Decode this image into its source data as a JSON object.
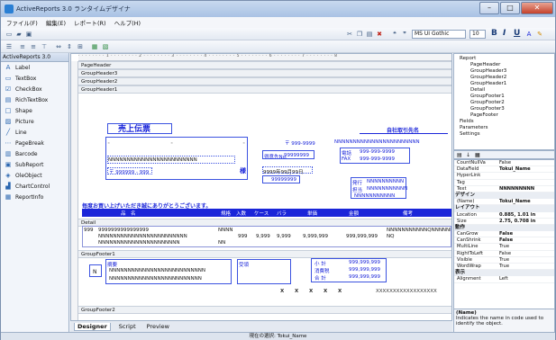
{
  "window": {
    "title": "ActiveReports 3.0 ランタイムデザイナ"
  },
  "menu": [
    "ファイル(F)",
    "編集(E)",
    "レポート(R)",
    "ヘルプ(H)"
  ],
  "toolbar": {
    "font_name": "MS UI Gothic",
    "font_size": "10",
    "bold": "B",
    "italic": "I",
    "underline": "U"
  },
  "toolbox": {
    "header": "ActiveReports 3.0",
    "items": [
      "Label",
      "TextBox",
      "CheckBox",
      "RichTextBox",
      "Shape",
      "Picture",
      "Line",
      "PageBreak",
      "Barcode",
      "SubReport",
      "OleObject",
      "ChartControl",
      "ReportInfo"
    ]
  },
  "bands": {
    "page_header": "PageHeader",
    "group_header3": "GroupHeader3",
    "group_header2": "GroupHeader2",
    "group_header1": "GroupHeader1",
    "detail": "Detail",
    "group_footer1": "GroupFooter1",
    "group_footer2": "GroupFooter2"
  },
  "report": {
    "title": "売上伝票",
    "company": "自社取引先名",
    "postal": "〒 999-9999",
    "address_fill": "NNNNNNNNNNNNNNNNNNNNNNN",
    "tel_label": "電話",
    "tel_value": "999-999-9999",
    "fax_label": "FAX",
    "fax_value": "999-999-9999",
    "customer_no_label": "得意先No.",
    "customer_no_value": "99999999",
    "customer_fill": "NNNNNNNNNNNNNNNNNNNNNNNN",
    "honorific": "様",
    "zip_value": "〒 999999 - 999",
    "date_value": "9999年99月99日",
    "slip_no_value": "99999999",
    "issuer_label": "発行",
    "issuer_value": "NNNNNNNNNN",
    "staff_label": "担当",
    "staff_value": "NNNNNNNNNNN",
    "note_value": "NNNNNNNNNNN",
    "thanks": "毎度お買い上げいただき誠にありがとうございます。",
    "columns": [
      "品　名",
      "規格",
      "入数",
      "ケース",
      "バラ",
      "単価",
      "金額",
      "備考"
    ],
    "detail_code": "999",
    "detail_code_fill": "9999999999999999",
    "detail_name1": "NNNNNNNNNNNNNNNNNNNNNNNN",
    "detail_name2": "NNNNNNNNNNNNNNNNNNNNNN",
    "detail_spec1": "NNNN",
    "detail_spec2": "NN",
    "detail_qty1": "999",
    "detail_qty2": "9,999",
    "detail_qty3": "9,999",
    "detail_price": "9,999,999",
    "detail_amount": "999,999,999",
    "detail_note": "NNNNNNNNNNNQNNNNNNNN NQ",
    "footer_n": "N",
    "footer_remarks_label": "摘要",
    "footer_fill1": "NNNNNNNNNNNNNNNNNNNNNNNNNN",
    "footer_fill2": "NNNNNNNNNNNNNNNNNNNNNNNNN",
    "footer_stamp_label": "受領",
    "subtotal_label": "小 計",
    "tax_label": "消費税",
    "total_label": "合 計",
    "money1": "999,999,999",
    "money2": "999,999,999",
    "money3": "999,999,999",
    "x_marks": [
      "X",
      "X",
      "X",
      "X",
      "X"
    ],
    "x_fill": "XXXXXXXXXXXXXXXXXX"
  },
  "tabs": [
    "Designer",
    "Script",
    "Preview"
  ],
  "status": "現在の選択: Tokui_Name",
  "tree": [
    {
      "label": "Report"
    },
    {
      "label": "PageHeader"
    },
    {
      "label": "GroupHeader3"
    },
    {
      "label": "GroupHeader2"
    },
    {
      "label": "GroupHeader1"
    },
    {
      "label": "Detail"
    },
    {
      "label": "GroupFooter1"
    },
    {
      "label": "GroupFooter2"
    },
    {
      "label": "GroupFooter3"
    },
    {
      "label": "PageFooter"
    },
    {
      "label": "Fields"
    },
    {
      "label": "Parameters"
    },
    {
      "label": "Settings"
    }
  ],
  "properties": [
    {
      "name": "CountNullVa",
      "value": "False"
    },
    {
      "name": "DataField",
      "value": "Tokui_Name"
    },
    {
      "name": "HyperLink",
      "value": ""
    },
    {
      "name": "Tag",
      "value": ""
    },
    {
      "name": "Text",
      "value": "NNNNNNNNN"
    },
    {
      "cat": "デザイン"
    },
    {
      "name": "(Name)",
      "value": "Tokui_Name"
    },
    {
      "cat": "レイアウト"
    },
    {
      "name": "Location",
      "value": "0.885, 1.01 in"
    },
    {
      "name": "Size",
      "value": "2.75, 0.708 in"
    },
    {
      "cat": "動作"
    },
    {
      "name": "CanGrow",
      "value": "False"
    },
    {
      "name": "CanShrink",
      "value": "False"
    },
    {
      "name": "MultiLine",
      "value": "True"
    },
    {
      "name": "RightToLeft",
      "value": "False"
    },
    {
      "name": "Visible",
      "value": "True"
    },
    {
      "name": "WordWrap",
      "value": "True"
    },
    {
      "cat": "表示"
    },
    {
      "name": "Alignment",
      "value": "Left"
    }
  ],
  "prop_desc": {
    "title": "(Name)",
    "body": "Indicates the name in code used to identify the object."
  },
  "colors": {
    "accent": "#1a25d9",
    "frame": "#7a8fae"
  }
}
